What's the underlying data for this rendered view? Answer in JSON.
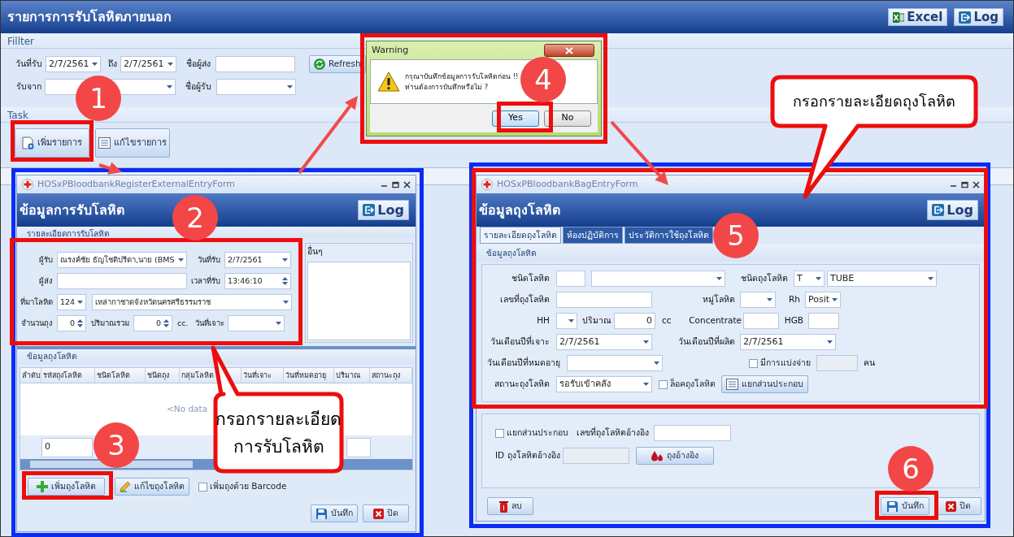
{
  "main_window": {
    "title": "รายการการรับโลหิตภายนอก",
    "toolbar_buttons": [
      {
        "kind": "excel",
        "label": "Excel"
      },
      {
        "kind": "log",
        "label": "Log"
      }
    ],
    "filter": {
      "title": "Fillter",
      "rows": [
        {
          "fields": [
            {
              "kind": "label",
              "text": "วันที่รับ"
            },
            {
              "kind": "dropdown",
              "value": "2/7/2561"
            },
            {
              "kind": "label",
              "text": "ถึง"
            },
            {
              "kind": "dropdown",
              "value": "2/7/2561"
            },
            {
              "kind": "label",
              "text": "ชื่อผู้ส่ง"
            },
            {
              "kind": "text"
            },
            {
              "kind": "refresh",
              "label": "Refresh"
            }
          ]
        },
        {
          "fields": [
            {
              "kind": "label",
              "text": "รับจาก"
            },
            {
              "kind": "dropdown"
            },
            {
              "kind": "label",
              "text": "ชื่อผู้รับ"
            },
            {
              "kind": "dropdown"
            }
          ]
        }
      ]
    },
    "task": {
      "title": "Task",
      "buttons": [
        {
          "kind": "new",
          "label": "เพิ่มรายการ"
        },
        {
          "kind": "edit_list",
          "label": "แก้ไขรายการ"
        }
      ]
    }
  },
  "register_dialog": {
    "title": "HOSxPBloodbankRegisterExternalEntryForm",
    "heading": "ข้อมูลการรับโลหิต",
    "log_button": "Log",
    "section": "รายละเอียดการรับโลหิต",
    "rows": [
      {
        "fields": [
          {
            "kind": "label",
            "text": "ผู้รับ"
          },
          {
            "kind": "dropdown",
            "value": "ณรงค์ชัย ธัญโชติปรีดา,นาย (BMS"
          },
          {
            "kind": "label",
            "text": "วันที่รับ"
          },
          {
            "kind": "dropdown",
            "value": "2/7/2561"
          }
        ]
      },
      {
        "fields": [
          {
            "kind": "label",
            "text": "ผู้ส่ง"
          },
          {
            "kind": "text"
          },
          {
            "kind": "label",
            "text": "เวลาที่รับ"
          },
          {
            "kind": "time",
            "value": "13:46:10"
          }
        ]
      },
      {
        "fields": [
          {
            "kind": "label",
            "text": "ที่มาโลหิต"
          },
          {
            "kind": "dropdown",
            "value": "124"
          },
          {
            "kind": "dropdown",
            "value": "เหล่ากาชาดจังหวัดนครศรีธรรมราช"
          }
        ]
      },
      {
        "fields": [
          {
            "kind": "label",
            "text": "จำนวนถุง"
          },
          {
            "kind": "spin",
            "value": "0"
          },
          {
            "kind": "label",
            "text": "ปริมาณรวม"
          },
          {
            "kind": "spin",
            "value": "0"
          },
          {
            "kind": "unit",
            "text": "cc."
          },
          {
            "kind": "label",
            "text": "วันที่เจาะ"
          },
          {
            "kind": "dropdown"
          }
        ]
      }
    ],
    "other_panel": "อื่นๆ",
    "grid": {
      "title": "ข้อมูลถุงโลหิต",
      "columns": [
        "ลำดับ",
        "รหัสถุงโลหิต",
        "ชนิดโลหิต",
        "ชนิดถุง",
        "กลุ่มโลหิต",
        "วันที่เจาะ",
        "วันที่หมดอายุ",
        "ปริมาณ",
        "สถานะถุง"
      ],
      "empty_text": "<No data",
      "footer_value": "0"
    },
    "actions": [
      {
        "kind": "add",
        "label": "เพิ่มถุงโลหิต"
      },
      {
        "kind": "edit",
        "label": "แก้ไขถุงโลหิต"
      },
      {
        "kind": "checkbox",
        "text": "เพิ่มถุงด้วย Barcode",
        "checked": false
      }
    ],
    "footer_buttons": [
      {
        "kind": "save",
        "label": "บันทึก"
      },
      {
        "kind": "close",
        "label": "ปิด"
      }
    ]
  },
  "warning_dialog": {
    "title": "Warning",
    "message": [
      "กรุณาบันทึกข้อมูลการรับโลหิตก่อน !!",
      "ท่านต้องการบันทึกหรือไม่ ?"
    ],
    "buttons": [
      {
        "label": "Yes",
        "selected": true
      },
      {
        "label": "No",
        "selected": false
      }
    ]
  },
  "bag_dialog": {
    "title": "HOSxPBloodbankBagEntryForm",
    "heading": "ข้อมูลถุงโลหิต",
    "log_button": "Log",
    "tabs": [
      {
        "label": "รายละเอียดถุงโลหิต",
        "selected": true
      },
      {
        "label": "ห้องปฏิบัติการ",
        "selected": false
      },
      {
        "label": "ประวัติการใช้ถุงโลหิต",
        "selected": false
      }
    ],
    "section": "ข้อมูลถุงโลหิต",
    "rows": [
      {
        "fields": [
          {
            "kind": "label",
            "text": "ชนิดโลหิต"
          },
          {
            "kind": "text"
          },
          {
            "kind": "dropdown"
          },
          {
            "kind": "label",
            "text": "ชนิดถุงโลหิต"
          },
          {
            "kind": "dropdown",
            "value": "T"
          },
          {
            "kind": "dropdown",
            "value": "TUBE"
          }
        ]
      },
      {
        "fields": [
          {
            "kind": "label",
            "text": "เลขที่ถุงโลหิต"
          },
          {
            "kind": "text"
          },
          {
            "kind": "label",
            "text": "หมู่โลหิต"
          },
          {
            "kind": "dropdown"
          },
          {
            "kind": "label",
            "text": "Rh"
          },
          {
            "kind": "dropdown",
            "value": "Posit"
          }
        ]
      },
      {
        "fields": [
          {
            "kind": "label",
            "text": "HH"
          },
          {
            "kind": "dropdown"
          },
          {
            "kind": "label",
            "text": "ปริมาณ"
          },
          {
            "kind": "number",
            "value": "0"
          },
          {
            "kind": "unit",
            "text": "cc"
          },
          {
            "kind": "label",
            "text": "Concentrate"
          },
          {
            "kind": "text"
          },
          {
            "kind": "label",
            "text": "HGB"
          },
          {
            "kind": "text"
          }
        ]
      },
      {
        "fields": [
          {
            "kind": "label",
            "text": "วันเดือนปีที่เจาะ"
          },
          {
            "kind": "dropdown",
            "value": "2/7/2561"
          },
          {
            "kind": "label",
            "text": "วันเดือนปีที่ผลิต"
          },
          {
            "kind": "dropdown",
            "value": "2/7/2561"
          }
        ]
      },
      {
        "fields": [
          {
            "kind": "label",
            "text": "วันเดือนปีที่หมดอายุ"
          },
          {
            "kind": "dropdown"
          },
          {
            "kind": "checkbox",
            "text": "มีการแบ่งจ่าย",
            "checked": false
          },
          {
            "kind": "readonly"
          },
          {
            "kind": "unit",
            "text": "คน"
          }
        ]
      },
      {
        "fields": [
          {
            "kind": "label",
            "text": "สถานะถุงโลหิต"
          },
          {
            "kind": "dropdown",
            "value": "รอรับเข้าคลัง"
          },
          {
            "kind": "checkbox",
            "text": "ล็อคถุงโลหิต",
            "checked": false
          },
          {
            "kind": "components",
            "label": "แยกส่วนประกอบ"
          }
        ]
      }
    ],
    "reference_rows": [
      {
        "fields": [
          {
            "kind": "checkbox",
            "text": "แยกส่วนประกอบ",
            "checked": false
          },
          {
            "kind": "label",
            "text": "เลขที่ถุงโลหิตอ้างอิง"
          },
          {
            "kind": "text"
          }
        ]
      },
      {
        "fields": [
          {
            "kind": "label",
            "text": "ID ถุงโลหิตอ้างอิง"
          },
          {
            "kind": "readonly"
          },
          {
            "kind": "reference",
            "label": "ถุงอ้างอิง"
          }
        ]
      }
    ],
    "footer_buttons": [
      {
        "kind": "delete",
        "label": "ลบ"
      },
      {
        "kind": "save",
        "label": "บันทึก"
      },
      {
        "kind": "close",
        "label": "ปิด"
      }
    ]
  },
  "annotations": {
    "steps": [
      "1",
      "2",
      "3",
      "4",
      "5",
      "6"
    ],
    "callouts": [
      {
        "lines": [
          "กรอกรายละเอียด",
          "การรับโลหิต"
        ]
      },
      {
        "lines": [
          "กรอกรายละเอียดถุงโลหิต"
        ]
      }
    ]
  }
}
